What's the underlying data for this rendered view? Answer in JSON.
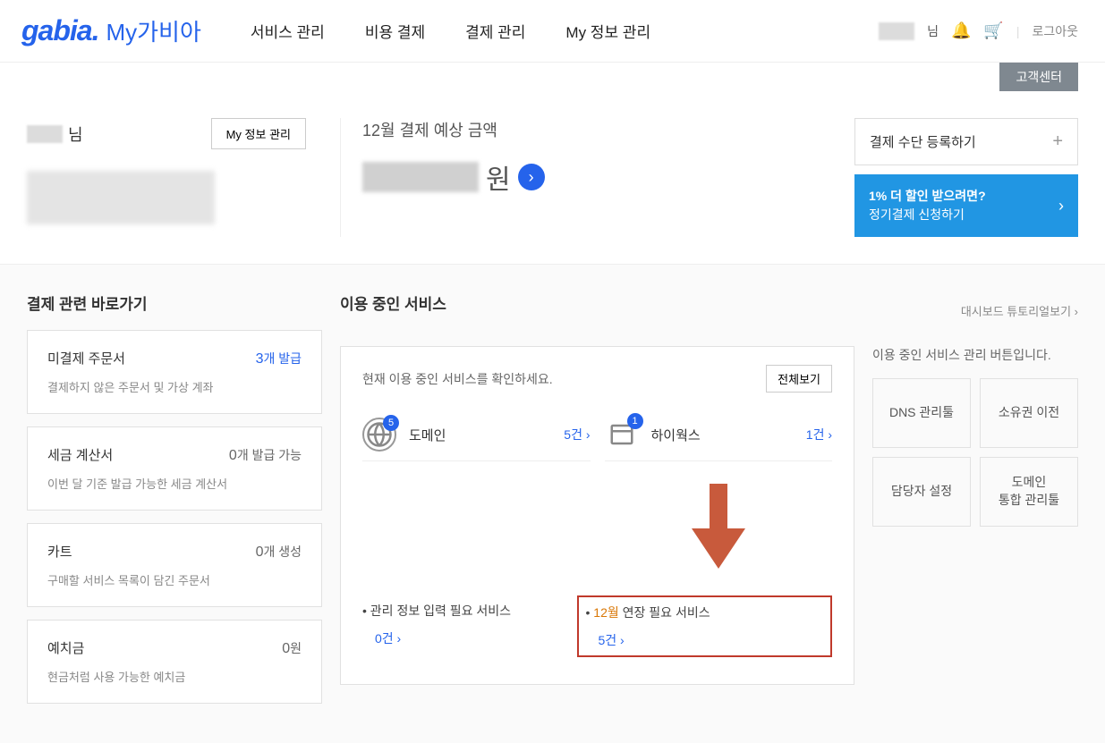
{
  "header": {
    "logo": "gabia.",
    "logo_sub": "My가비아",
    "nav": [
      "서비스 관리",
      "비용 결제",
      "결제 관리",
      "My 정보 관리"
    ],
    "user_suffix": "님",
    "logout": "로그아웃",
    "cs_button": "고객센터"
  },
  "user_box": {
    "suffix": "님",
    "my_info_btn": "My 정보 관리"
  },
  "payment_box": {
    "label": "12월 결제 예상 금액",
    "currency": "원"
  },
  "promo": {
    "register": "결제 수단 등록하기",
    "discount_line1": "1% 더 할인 받으려면?",
    "discount_line2": "정기결제 신청하기"
  },
  "sidebar": {
    "title": "결제 관련 바로가기",
    "cards": [
      {
        "title": "미결제 주문서",
        "num": "3",
        "unit": "개 발급",
        "blue": true,
        "desc": "결제하지 않은 주문서 및 가상 계좌"
      },
      {
        "title": "세금 계산서",
        "num": "0",
        "unit": "개 발급 가능",
        "blue": false,
        "desc": "이번 달 기준 발급 가능한 세금 계산서"
      },
      {
        "title": "카트",
        "num": "0",
        "unit": "개 생성",
        "blue": false,
        "desc": "구매할 서비스 목록이 담긴 주문서"
      },
      {
        "title": "예치금",
        "num": "0",
        "unit": "원",
        "blue": false,
        "desc": "현금처럼 사용 가능한 예치금"
      }
    ]
  },
  "content": {
    "title": "이용 중인 서비스",
    "tutorial": "대시보드 튜토리얼보기 ›",
    "hint": "현재 이용 중인 서비스를 확인하세요.",
    "view_all": "전체보기",
    "services": [
      {
        "name": "도메인",
        "badge": "5",
        "count": "5건 ›"
      },
      {
        "name": "하이웍스",
        "badge": "1",
        "count": "1건 ›"
      }
    ],
    "bullets": [
      {
        "prefix": "• ",
        "month": "",
        "text": "관리 정보 입력 필요 서비스",
        "link": "0건 ›",
        "highlight": false
      },
      {
        "prefix": "• ",
        "month": "12월",
        "text": " 연장 필요 서비스",
        "link": "5건 ›",
        "highlight": true
      }
    ]
  },
  "mgmt": {
    "hint": "이용 중인 서비스 관리 버튼입니다.",
    "buttons": [
      "DNS 관리툴",
      "소유권 이전",
      "담당자 설정",
      "도메인\n통합 관리툴"
    ]
  }
}
